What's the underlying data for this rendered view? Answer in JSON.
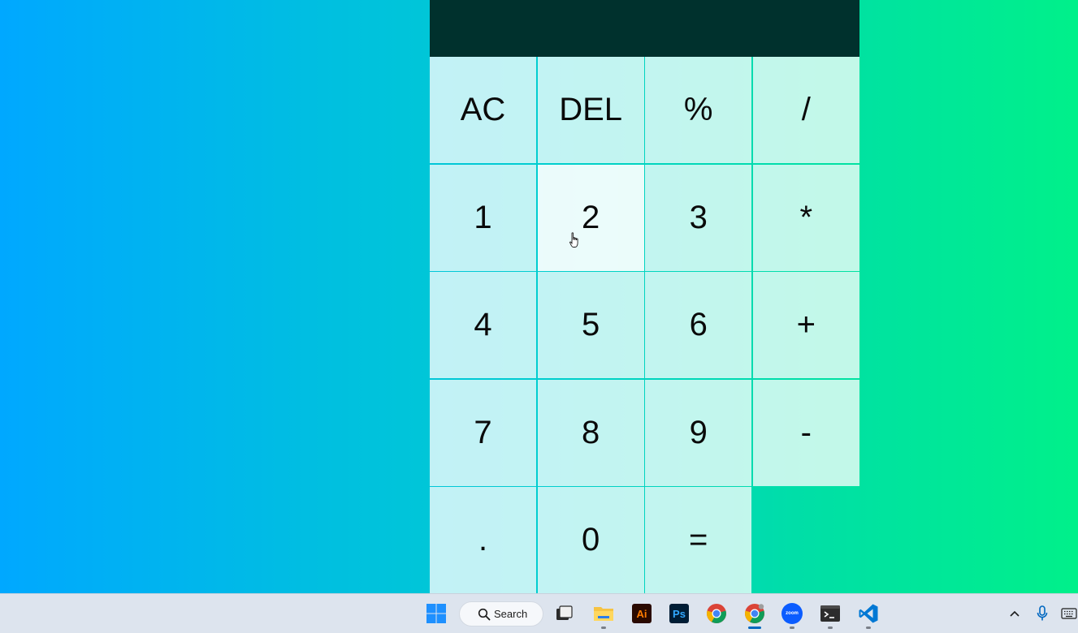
{
  "display": {
    "value": ""
  },
  "keys": [
    {
      "label": "AC",
      "name": "all-clear-button"
    },
    {
      "label": "DEL",
      "name": "delete-button"
    },
    {
      "label": "%",
      "name": "percent-button"
    },
    {
      "label": "/",
      "name": "divide-button"
    },
    {
      "label": "1",
      "name": "digit-1-button"
    },
    {
      "label": "2",
      "name": "digit-2-button"
    },
    {
      "label": "3",
      "name": "digit-3-button"
    },
    {
      "label": "*",
      "name": "multiply-button"
    },
    {
      "label": "4",
      "name": "digit-4-button"
    },
    {
      "label": "5",
      "name": "digit-5-button"
    },
    {
      "label": "6",
      "name": "digit-6-button"
    },
    {
      "label": "+",
      "name": "add-button"
    },
    {
      "label": "7",
      "name": "digit-7-button"
    },
    {
      "label": "8",
      "name": "digit-8-button"
    },
    {
      "label": "9",
      "name": "digit-9-button"
    },
    {
      "label": "-",
      "name": "subtract-button"
    },
    {
      "label": ".",
      "name": "decimal-button"
    },
    {
      "label": "0",
      "name": "digit-0-button"
    },
    {
      "label": "=",
      "name": "equals-button"
    }
  ],
  "hovered_key": "2",
  "colors": {
    "display_background": "#00312d",
    "taskbar_background": "#dde4ee",
    "active_indicator": "#0067c0"
  },
  "taskbar": {
    "search_label": "Search",
    "apps": [
      {
        "icon": "windows-start-icon"
      },
      {
        "icon": "search-icon"
      },
      {
        "icon": "task-view-icon"
      },
      {
        "icon": "file-explorer-icon"
      },
      {
        "icon": "adobe-illustrator-icon",
        "text": "Ai"
      },
      {
        "icon": "adobe-photoshop-icon",
        "text": "Ps"
      },
      {
        "icon": "chrome-icon"
      },
      {
        "icon": "chrome-dev-icon",
        "active": true
      },
      {
        "icon": "zoom-icon",
        "text": "zoom"
      },
      {
        "icon": "terminal-icon"
      },
      {
        "icon": "vscode-icon"
      }
    ],
    "tray": [
      {
        "icon": "chevron-up-icon"
      },
      {
        "icon": "microphone-icon"
      },
      {
        "icon": "keyboard-icon"
      }
    ]
  }
}
